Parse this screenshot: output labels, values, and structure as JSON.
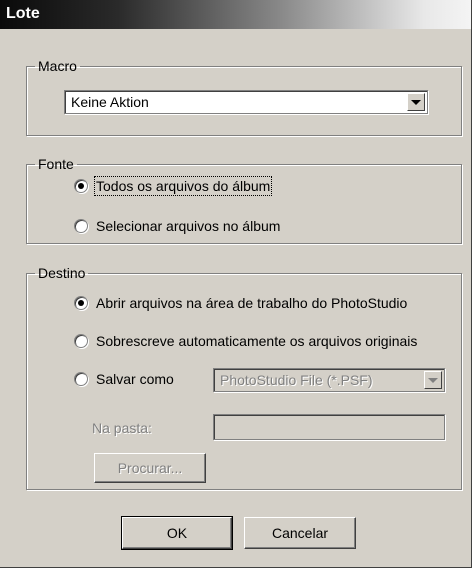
{
  "window": {
    "title": "Lote"
  },
  "macro": {
    "legend": "Macro",
    "selected": "Keine Aktion"
  },
  "fonte": {
    "legend": "Fonte",
    "options": [
      {
        "label": "Todos os arquivos do álbum",
        "checked": true
      },
      {
        "label": "Selecionar arquivos no álbum",
        "checked": false
      }
    ]
  },
  "destino": {
    "legend": "Destino",
    "options": [
      {
        "label": "Abrir arquivos na área de trabalho do PhotoStudio",
        "checked": true
      },
      {
        "label": "Sobrescreve automaticamente os arquivos originais",
        "checked": false
      },
      {
        "label": "Salvar como",
        "checked": false
      }
    ],
    "format_selected": "PhotoStudio File (*.PSF)",
    "folder_label": "Na pasta:",
    "folder_value": "",
    "browse_label": "Procurar..."
  },
  "buttons": {
    "ok": "OK",
    "cancel": "Cancelar"
  }
}
